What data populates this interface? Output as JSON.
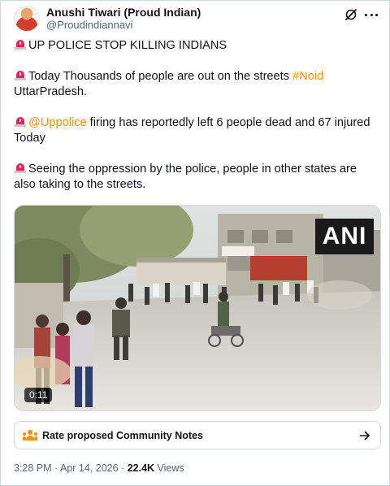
{
  "author": {
    "display_name": "Anushi Tiwari (Proud Indian)",
    "handle": "@Proudindiannavi"
  },
  "post": {
    "line1": "UP POLICE STOP KILLING INDIANS",
    "line2_pre": "Today Thousands of people are out on the streets ",
    "line2_hashtag": "#Noid",
    "line2_post": "UttarPradesh.",
    "line3_mention": "@Uppolice",
    "line3_post": " firing has reportedly left 6 people dead and 67 injured Today",
    "line4": "Seeing the oppression by the police, people in other states are also taking to the streets.",
    "emoji": "police-car-light-icon"
  },
  "media": {
    "badge": "ANI",
    "duration": "0:11"
  },
  "community_notes": {
    "label": "Rate proposed Community Notes"
  },
  "meta": {
    "time": "3:28 PM",
    "separator": " · ",
    "date": "Apr 14, 2026",
    "views_count": "22.4K",
    "views_label": " Views"
  },
  "colors": {
    "text": "#0f1419",
    "secondary": "#536471",
    "hashtag": "#f4900c",
    "border": "#cfd9de"
  }
}
